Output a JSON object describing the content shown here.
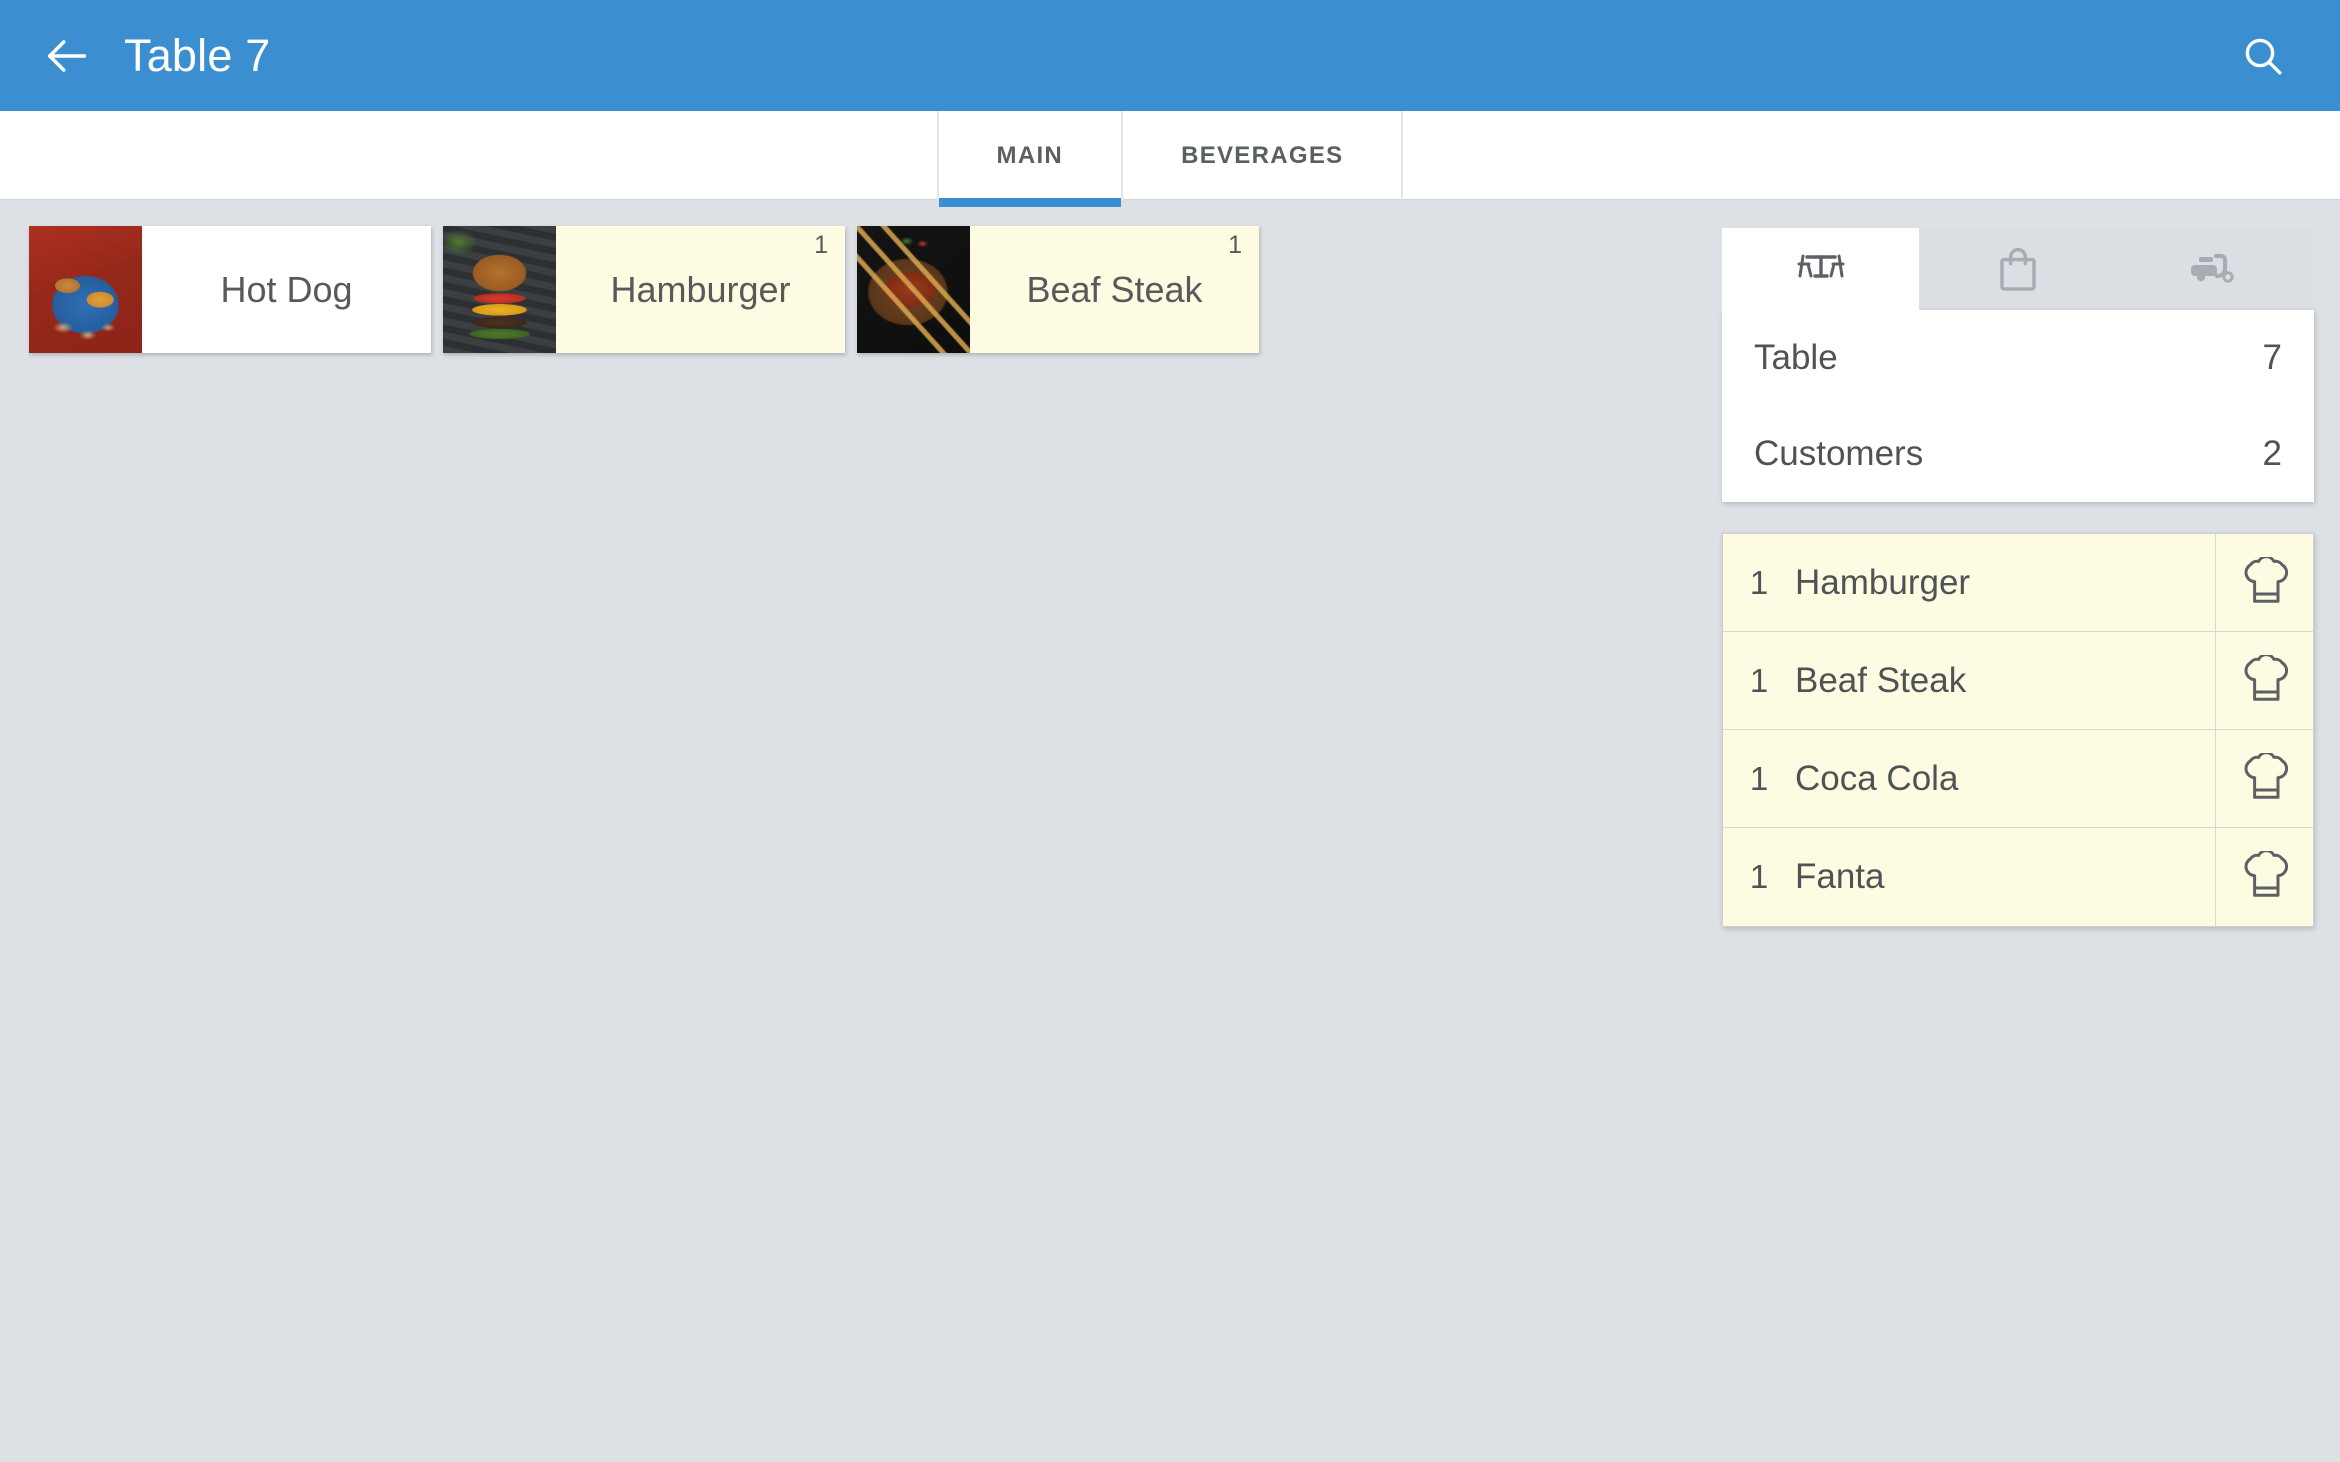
{
  "appbar": {
    "title": "Table 7",
    "back_icon": "arrow-left-icon",
    "search_icon": "search-icon",
    "background_color": "#3b8fd0"
  },
  "category_tabs": {
    "active_index": 0,
    "items": [
      {
        "label": "MAIN"
      },
      {
        "label": "BEVERAGES"
      }
    ]
  },
  "products": [
    {
      "name": "Hot Dog",
      "qty": "",
      "selected": false,
      "thumb": "hotdog-photo"
    },
    {
      "name": "Hamburger",
      "qty": "1",
      "selected": true,
      "thumb": "hamburger-photo"
    },
    {
      "name": "Beaf Steak",
      "qty": "1",
      "selected": true,
      "thumb": "steak-photo"
    }
  ],
  "order_panel": {
    "mode_tabs": [
      {
        "icon": "dine-in-table-icon",
        "active": true
      },
      {
        "icon": "takeaway-bag-icon",
        "active": false
      },
      {
        "icon": "delivery-scooter-icon",
        "active": false
      }
    ],
    "info": [
      {
        "label": "Table",
        "value": "7"
      },
      {
        "label": "Customers",
        "value": "2"
      }
    ],
    "items": [
      {
        "qty": "1",
        "name": "Hamburger",
        "action_icon": "chef-hat-icon"
      },
      {
        "qty": "1",
        "name": "Beaf Steak",
        "action_icon": "chef-hat-icon"
      },
      {
        "qty": "1",
        "name": "Coca Cola",
        "action_icon": "chef-hat-icon"
      },
      {
        "qty": "1",
        "name": "Fanta",
        "action_icon": "chef-hat-icon"
      }
    ]
  },
  "colors": {
    "accent": "#3b8fd0",
    "page_background": "#dde1e5",
    "selected_item": "#fdfbe1",
    "text_primary": "#4f5356"
  }
}
